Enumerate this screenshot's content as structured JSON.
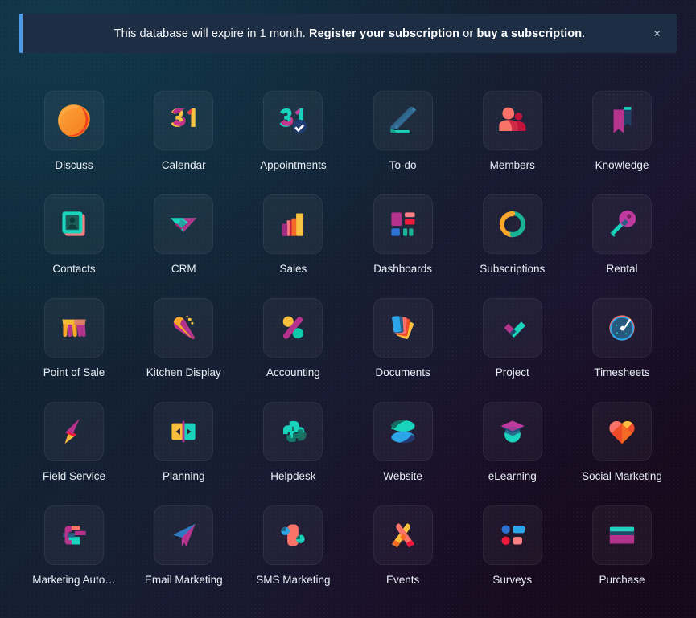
{
  "alert": {
    "prefix": "This database will expire in 1 month. ",
    "link1": "Register your subscription",
    "middle": " or ",
    "link2": "buy a subscription",
    "suffix": ".",
    "close_label": "×",
    "accent_color": "#4a9ae8",
    "background_color": "#1d2d44"
  },
  "theme": {
    "background_start": "#0d2b3a",
    "background_end": "#130a18",
    "tile_background": "rgba(255,255,255,0.045)",
    "label_color": "#e8eef5"
  },
  "apps": [
    {
      "label": "Discuss",
      "icon": "discuss-icon"
    },
    {
      "label": "Calendar",
      "icon": "calendar-icon"
    },
    {
      "label": "Appointments",
      "icon": "appointments-icon"
    },
    {
      "label": "To-do",
      "icon": "todo-icon"
    },
    {
      "label": "Members",
      "icon": "members-icon"
    },
    {
      "label": "Knowledge",
      "icon": "knowledge-icon"
    },
    {
      "label": "Contacts",
      "icon": "contacts-icon"
    },
    {
      "label": "CRM",
      "icon": "crm-icon"
    },
    {
      "label": "Sales",
      "icon": "sales-icon"
    },
    {
      "label": "Dashboards",
      "icon": "dashboards-icon"
    },
    {
      "label": "Subscriptions",
      "icon": "subscriptions-icon"
    },
    {
      "label": "Rental",
      "icon": "rental-icon"
    },
    {
      "label": "Point of Sale",
      "icon": "point-of-sale-icon"
    },
    {
      "label": "Kitchen Display",
      "icon": "kitchen-display-icon"
    },
    {
      "label": "Accounting",
      "icon": "accounting-icon"
    },
    {
      "label": "Documents",
      "icon": "documents-icon"
    },
    {
      "label": "Project",
      "icon": "project-icon"
    },
    {
      "label": "Timesheets",
      "icon": "timesheets-icon"
    },
    {
      "label": "Field Service",
      "icon": "field-service-icon"
    },
    {
      "label": "Planning",
      "icon": "planning-icon"
    },
    {
      "label": "Helpdesk",
      "icon": "helpdesk-icon"
    },
    {
      "label": "Website",
      "icon": "website-icon"
    },
    {
      "label": "eLearning",
      "icon": "elearning-icon"
    },
    {
      "label": "Social Marketing",
      "icon": "social-marketing-icon"
    },
    {
      "label": "Marketing Auto…",
      "icon": "marketing-automation-icon"
    },
    {
      "label": "Email Marketing",
      "icon": "email-marketing-icon"
    },
    {
      "label": "SMS Marketing",
      "icon": "sms-marketing-icon"
    },
    {
      "label": "Events",
      "icon": "events-icon"
    },
    {
      "label": "Surveys",
      "icon": "surveys-icon"
    },
    {
      "label": "Purchase",
      "icon": "purchase-icon"
    }
  ]
}
